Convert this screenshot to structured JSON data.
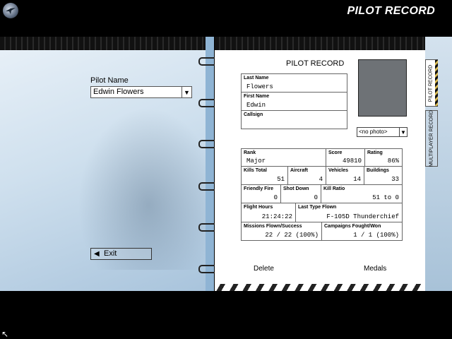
{
  "header": {
    "title": "PILOT RECORD",
    "logo_icon": "globe-logo-icon"
  },
  "left": {
    "pilot_name_label": "Pilot Name",
    "pilot_name_value": "Edwin Flowers",
    "exit_label": "Exit"
  },
  "record": {
    "title": "PILOT RECORD",
    "last_name_label": "Last Name",
    "last_name": "Flowers",
    "first_name_label": "First Name",
    "first_name": "Edwin",
    "callsign_label": "Callsign",
    "callsign": "",
    "photo_option": "<no photo>",
    "rank_label": "Rank",
    "rank": "Major",
    "score_label": "Score",
    "score": "49810",
    "rating_label": "Rating",
    "rating": "86%",
    "kills_total_label": "Kills Total",
    "kills_total": "51",
    "aircraft_label": "Aircraft",
    "aircraft": "4",
    "vehicles_label": "Vehicles",
    "vehicles": "14",
    "buildings_label": "Buildings",
    "buildings": "33",
    "friendly_fire_label": "Friendly Fire",
    "friendly_fire": "0",
    "shot_down_label": "Shot Down",
    "shot_down": "0",
    "kill_ratio_label": "Kill Ratio",
    "kill_ratio": "51 to 0",
    "flight_hours_label": "Flight Hours",
    "flight_hours": "21:24:22",
    "last_type_label": "Last Type Flown",
    "last_type": "F-105D Thunderchief",
    "missions_label": "Missions Flown/Success",
    "missions": "22 / 22 (100%)",
    "campaigns_label": "Campaigns Fought/Won",
    "campaigns": "1 / 1 (100%)",
    "delete_label": "Delete",
    "medals_label": "Medals"
  },
  "tabs": {
    "pilot_record": "PILOT RECORD",
    "multiplayer_record": "MULTIPLAYER RECORD"
  }
}
